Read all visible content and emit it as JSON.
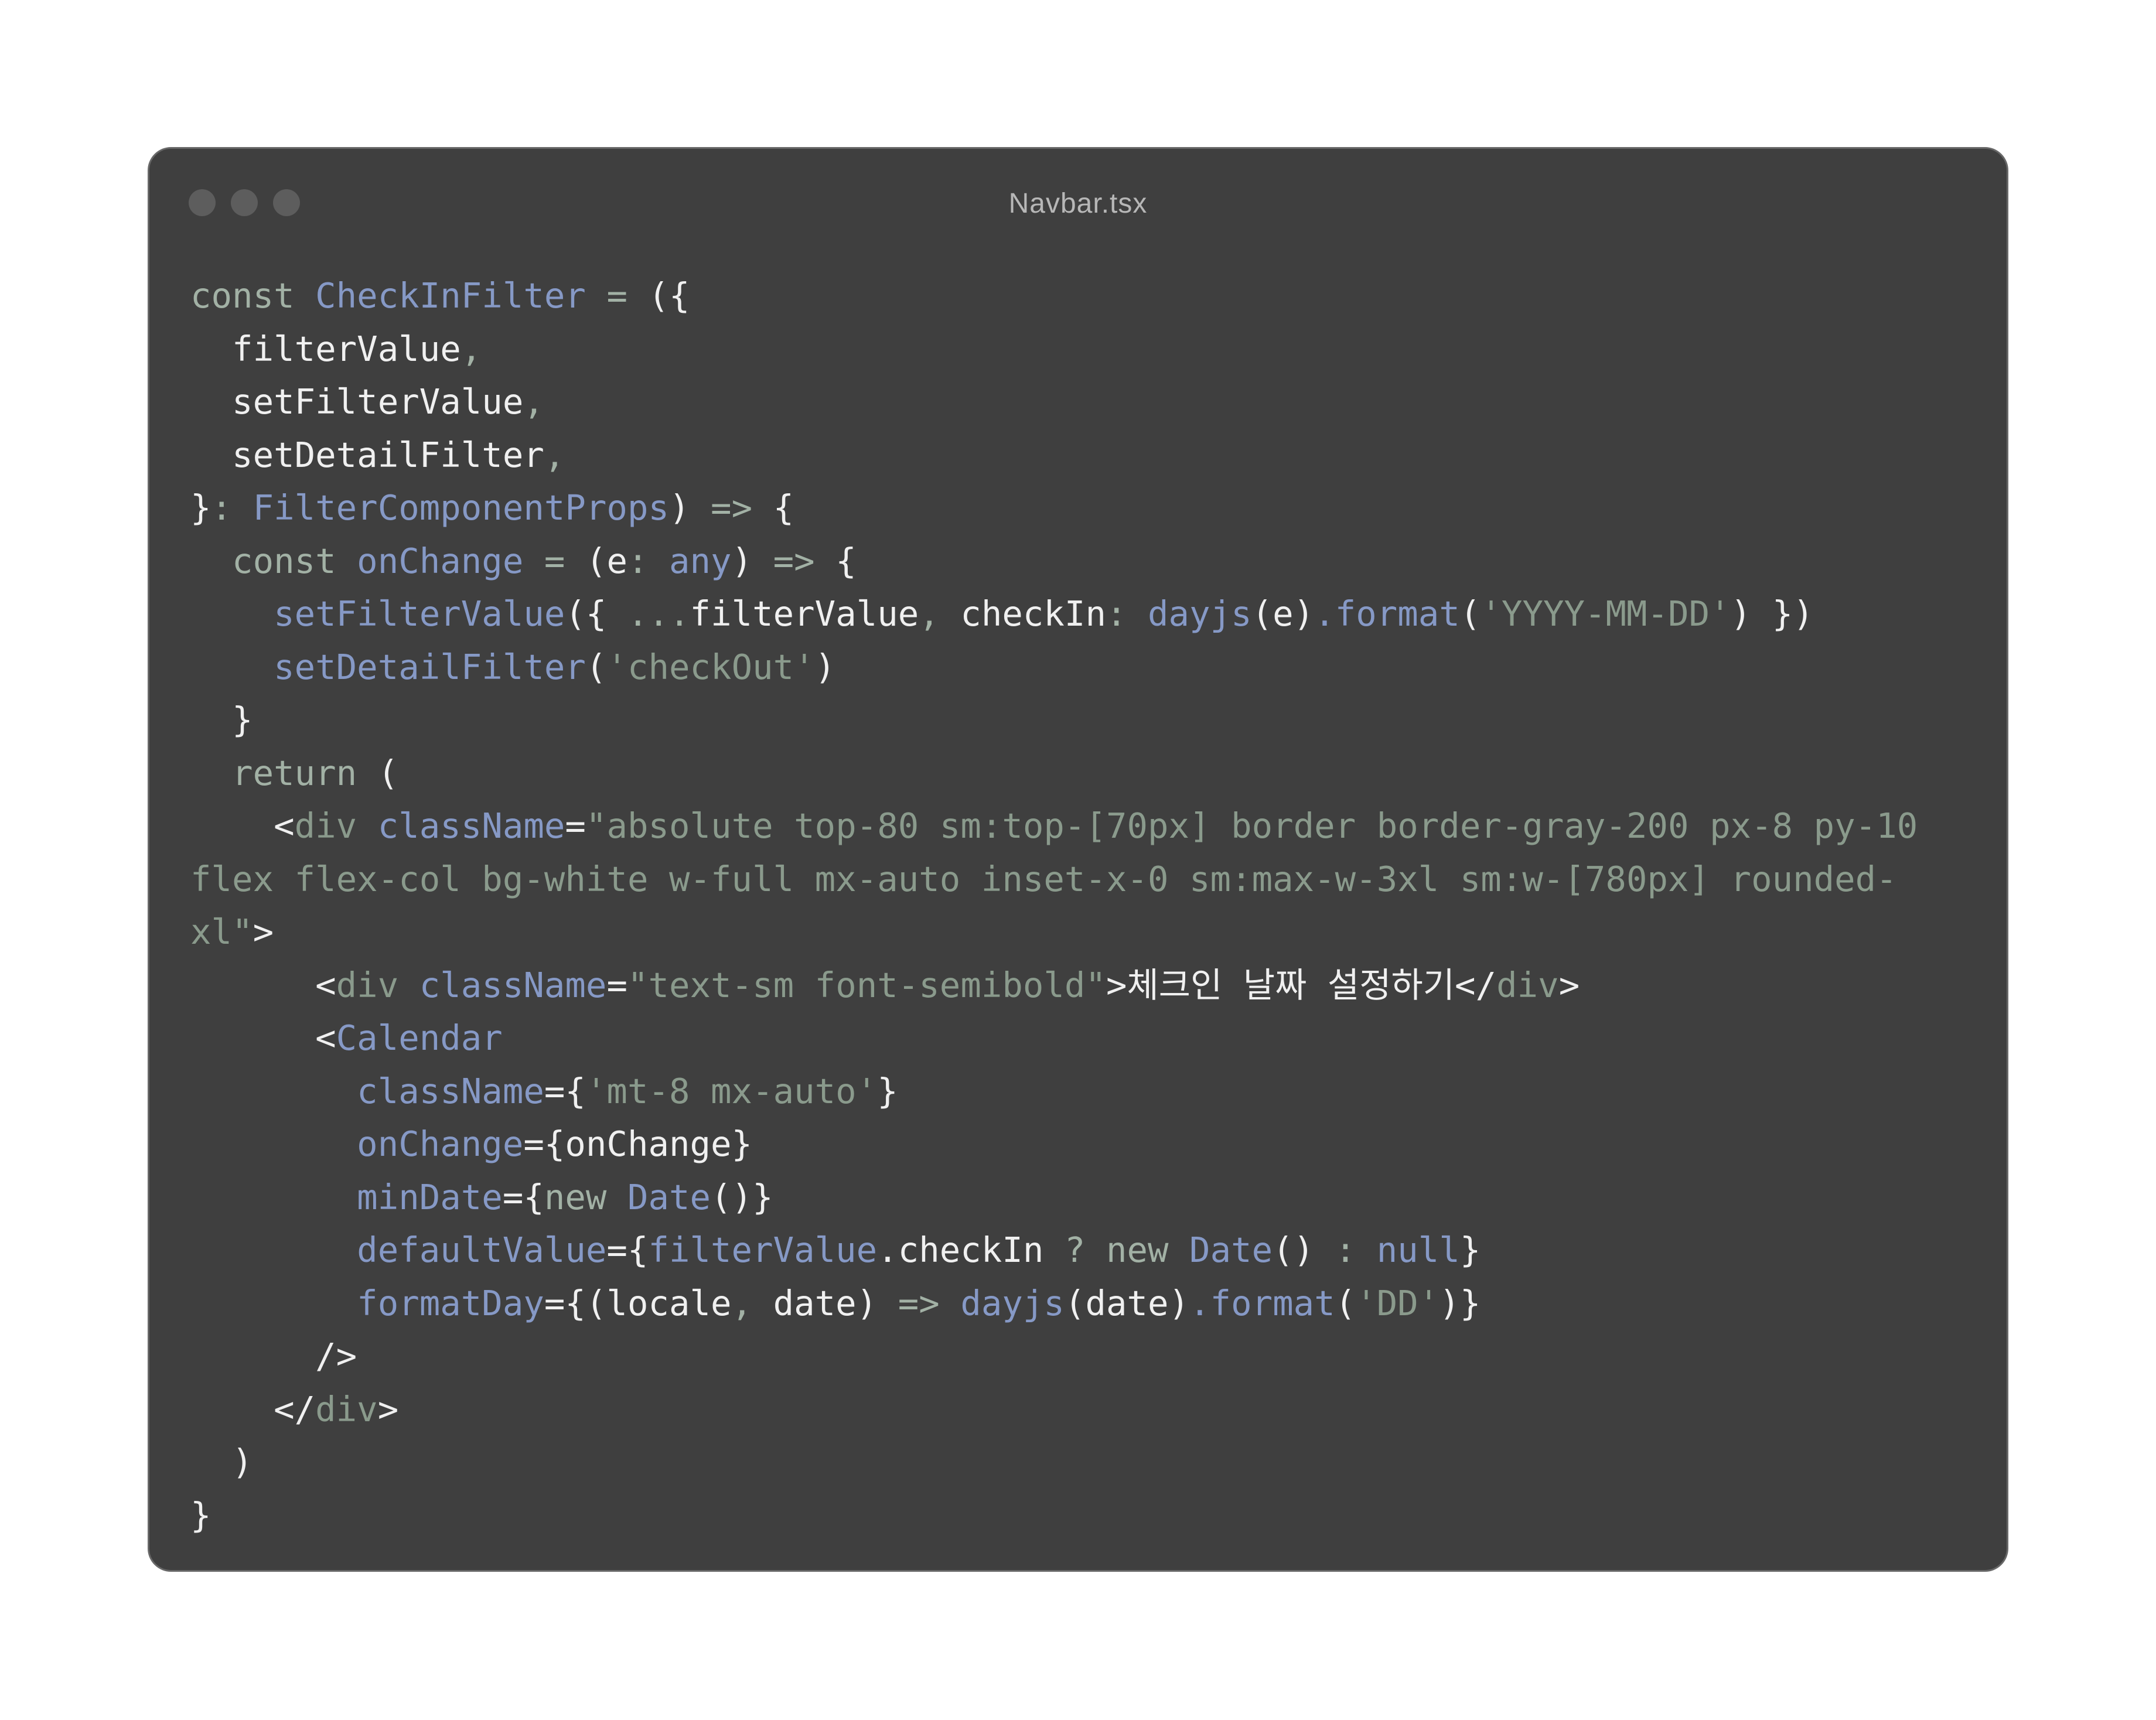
{
  "window": {
    "title": "Navbar.tsx",
    "controls": [
      "close",
      "minimize",
      "zoom"
    ]
  },
  "colors": {
    "page_background": "#ffffff",
    "window_background": "#3f3f3f",
    "window_border": "#686868",
    "control_dot": "#5d5d5d",
    "title_text": "#b7b7b7",
    "text": "#f0f0f0",
    "keyword": "#a2b1a5",
    "name": "#8699c6",
    "string": "#8a9a8c",
    "punctuation": "#a2b1a5"
  },
  "code": {
    "lines": [
      [
        [
          "keyword",
          "const "
        ],
        [
          "name",
          "CheckInFilter"
        ],
        [
          "keyword",
          " = "
        ],
        [
          "text",
          "({"
        ]
      ],
      [
        [
          "text",
          "  filterValue"
        ],
        [
          "punctuation",
          ","
        ]
      ],
      [
        [
          "text",
          "  setFilterValue"
        ],
        [
          "punctuation",
          ","
        ]
      ],
      [
        [
          "text",
          "  setDetailFilter"
        ],
        [
          "punctuation",
          ","
        ]
      ],
      [
        [
          "text",
          "}"
        ],
        [
          "punctuation",
          ": "
        ],
        [
          "name",
          "FilterComponentProps"
        ],
        [
          "text",
          ")"
        ],
        [
          "keyword",
          " => "
        ],
        [
          "text",
          "{"
        ]
      ],
      [
        [
          "keyword",
          "  const "
        ],
        [
          "name",
          "onChange"
        ],
        [
          "keyword",
          " = "
        ],
        [
          "text",
          "(e"
        ],
        [
          "punctuation",
          ": "
        ],
        [
          "name",
          "any"
        ],
        [
          "text",
          ")"
        ],
        [
          "keyword",
          " => "
        ],
        [
          "text",
          "{"
        ]
      ],
      [
        [
          "name",
          "    setFilterValue"
        ],
        [
          "text",
          "({ "
        ],
        [
          "punctuation",
          "..."
        ],
        [
          "text",
          "filterValue"
        ],
        [
          "punctuation",
          ", "
        ],
        [
          "text",
          "checkIn"
        ],
        [
          "punctuation",
          ": "
        ],
        [
          "name",
          "dayjs"
        ],
        [
          "text",
          "(e)"
        ],
        [
          "name",
          ".format"
        ],
        [
          "text",
          "("
        ],
        [
          "string",
          "'YYYY-MM-DD'"
        ],
        [
          "text",
          ") })"
        ]
      ],
      [
        [
          "name",
          "    setDetailFilter"
        ],
        [
          "text",
          "("
        ],
        [
          "string",
          "'checkOut'"
        ],
        [
          "text",
          ")"
        ]
      ],
      [
        [
          "text",
          "  }"
        ]
      ],
      [
        [
          "keyword",
          "  return "
        ],
        [
          "text",
          "("
        ]
      ],
      [
        [
          "text",
          "    <"
        ],
        [
          "string",
          "div "
        ],
        [
          "name",
          "className"
        ],
        [
          "text",
          "="
        ],
        [
          "string",
          "\"absolute top-80 sm:top-[70px] border border-gray-200 px-8 py-10"
        ]
      ],
      [
        [
          "string",
          "flex flex-col bg-white w-full mx-auto inset-x-0 sm:max-w-3xl sm:w-[780px] rounded-"
        ]
      ],
      [
        [
          "string",
          "xl\""
        ],
        [
          "text",
          ">"
        ]
      ],
      [
        [
          "text",
          "      <"
        ],
        [
          "string",
          "div "
        ],
        [
          "name",
          "className"
        ],
        [
          "text",
          "="
        ],
        [
          "string",
          "\"text-sm font-semibold\""
        ],
        [
          "text",
          ">체크인 날짜 설정하기</"
        ],
        [
          "string",
          "div"
        ],
        [
          "text",
          ">"
        ]
      ],
      [
        [
          "text",
          "      <"
        ],
        [
          "name",
          "Calendar"
        ]
      ],
      [
        [
          "name",
          "        className"
        ],
        [
          "text",
          "={"
        ],
        [
          "string",
          "'mt-8 mx-auto'"
        ],
        [
          "text",
          "}"
        ]
      ],
      [
        [
          "name",
          "        onChange"
        ],
        [
          "text",
          "={onChange}"
        ]
      ],
      [
        [
          "name",
          "        minDate"
        ],
        [
          "text",
          "={"
        ],
        [
          "keyword",
          "new "
        ],
        [
          "name",
          "Date"
        ],
        [
          "text",
          "()}"
        ]
      ],
      [
        [
          "name",
          "        defaultValue"
        ],
        [
          "text",
          "={"
        ],
        [
          "name",
          "filterValue"
        ],
        [
          "text",
          ".checkIn "
        ],
        [
          "keyword",
          "? new "
        ],
        [
          "name",
          "Date"
        ],
        [
          "text",
          "() "
        ],
        [
          "keyword",
          ": "
        ],
        [
          "name",
          "null"
        ],
        [
          "text",
          "}"
        ]
      ],
      [
        [
          "name",
          "        formatDay"
        ],
        [
          "text",
          "={(locale"
        ],
        [
          "punctuation",
          ", "
        ],
        [
          "text",
          "date) "
        ],
        [
          "keyword",
          "=> "
        ],
        [
          "name",
          "dayjs"
        ],
        [
          "text",
          "(date)"
        ],
        [
          "name",
          ".format"
        ],
        [
          "text",
          "("
        ],
        [
          "string",
          "'DD'"
        ],
        [
          "text",
          ")}"
        ]
      ],
      [
        [
          "text",
          "      />"
        ]
      ],
      [
        [
          "text",
          "    </"
        ],
        [
          "string",
          "div"
        ],
        [
          "text",
          ">"
        ]
      ],
      [
        [
          "text",
          "  )"
        ]
      ],
      [
        [
          "text",
          "}"
        ]
      ]
    ]
  }
}
